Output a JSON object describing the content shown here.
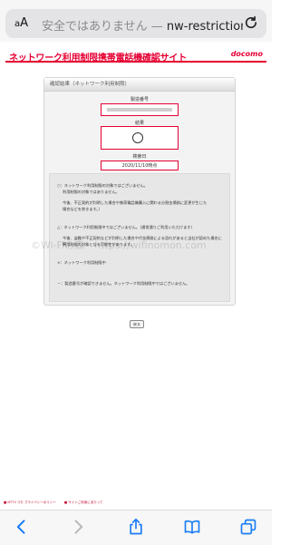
{
  "browser": {
    "aa_label": "AA",
    "security_warning": "安全ではありません",
    "separator": " — ",
    "url": "nw-restriction"
  },
  "site": {
    "title": "ネットワーク利用制限携帯電話機確認サイト",
    "brand": "docomo"
  },
  "panel": {
    "header": "確認結果（ネットワーク利用制限）",
    "imei_label": "製造番号",
    "result_label": "結果",
    "result_value": "○",
    "date_label": "検索日",
    "date_value": "2020/11/10時点"
  },
  "notes": {
    "circle_title": "○：ネットワーク利用制限の対象ではございません。",
    "circle_line1": "利用制限の対象ではありません。",
    "circle_line2": "今後、不正契約が判明した場合や携帯電話機購入に関わる分割金債務に変更が生じた",
    "circle_line3": "場合などを除きます。）",
    "triangle_title": "△：ネットワーク利用制限中ではございません。（通常通りご利用いただけます）",
    "triangle_line1": "今後、盗難や不正契約などが判明した場合や代金債務による恐れがあると当社が認めた場合には",
    "triangle_line2": "利用制限の対象となる可能性があります。",
    "cross_title": "×：ネットワーク利用制限中",
    "dash_title": "－：製造番号が確認できません。ネットワーク利用制限中ではございません。"
  },
  "actions": {
    "back_label": "戻る"
  },
  "footer": {
    "link1": "■ NTTドコモ プライバシーポリシー",
    "link2": "■ サイトご利用にあたって"
  },
  "watermark": "©Wi-Fiの森　https://wifinomon.com",
  "colors": {
    "brand_red": "#e60033",
    "ios_blue": "#1a7cf5"
  },
  "icons": {
    "reload": "reload-icon",
    "back": "chevron-left-icon",
    "forward": "chevron-right-icon",
    "share": "share-icon",
    "bookmarks": "book-icon",
    "tabs": "tabs-icon"
  }
}
